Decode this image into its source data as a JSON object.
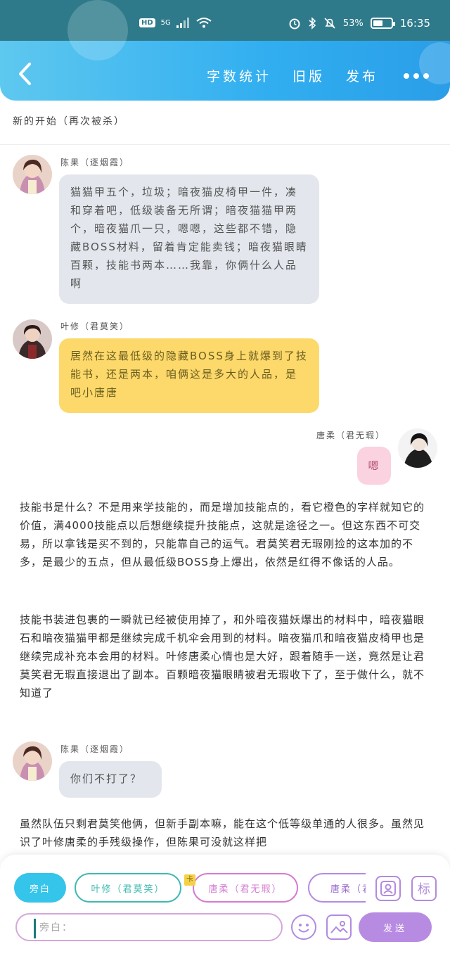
{
  "status_bar": {
    "network_badge": "HD",
    "signal_label": "5G",
    "battery_percent": "53%",
    "time": "16:35",
    "battery_level": 0.53
  },
  "header": {
    "actions": [
      "字数统计",
      "旧版",
      "发布"
    ]
  },
  "chapter": {
    "title": "新的开始（再次被杀）"
  },
  "messages": [
    {
      "speaker": "陈果（逐烟霞）",
      "style": "gray",
      "side": "left",
      "text": "猫猫甲五个，垃圾；暗夜猫皮椅甲一件，凑和穿着吧，低级装备无所谓；暗夜猫猫甲两个，暗夜猫爪一只，嗯嗯，这些都不错，隐藏BOSS材料，留着肯定能卖钱；暗夜猫眼睛百颗，技能书两本……我靠，你俩什么人品啊"
    },
    {
      "speaker": "叶修（君莫笑）",
      "style": "yellow",
      "side": "left",
      "text": "居然在这最低级的隐藏BOSS身上就爆到了技能书，还是两本，咱俩这是多大的人品，是吧小唐唐"
    },
    {
      "speaker": "唐柔（君无瑕）",
      "style": "pink",
      "side": "right",
      "text": "嗯"
    },
    {
      "speaker": "陈果（逐烟霞）",
      "style": "gray",
      "side": "left",
      "text": "你们不打了？"
    }
  ],
  "narrations": [
    "技能书是什么？不是用来学技能的，而是增加技能点的，看它橙色的字样就知它的价值，满4000技能点以后想继续提升技能点，这就是途径之一。但这东西不可交易，所以拿钱是买不到的，只能靠自己的运气。君莫笑君无瑕刚捡的这本加的不多，是最少的五点，但从最低级BOSS身上爆出，依然是红得不像话的人品。",
    "技能书装进包裹的一瞬就已经被使用掉了，和外暗夜猫妖爆出的材料中，暗夜猫眼石和暗夜猫猫甲都是继续完成千机伞会用到的材料。暗夜猫爪和暗夜猫皮椅甲也是继续完成补充本会用的材料。叶修唐柔心情也是大好，跟着随手一送，竟然是让君莫笑君无瑕直接退出了副本。百颗暗夜猫眼睛被君无瑕收下了，至于做什么，就不知道了",
    "虽然队伍只剩君莫笑他俩，但新手副本嘛，能在这个低等级单通的人很多。虽然见识了叶修唐柔的手残级操作，但陈果可没就这样把"
  ],
  "bottom": {
    "roles": [
      "旁白",
      "叶修（君莫笑）",
      "唐柔（君无瑕）",
      "唐柔（君无瑕）"
    ],
    "pin_mark": "卡",
    "tag_button": "标",
    "input_placeholder": "旁白：",
    "send_label": "发送"
  },
  "colors": {
    "header": "#31aef0",
    "narrator_chip": "#35c4ea",
    "send": "#b88be3",
    "bubble_gray": "#e3e7ed",
    "bubble_yellow": "#fcd96a",
    "bubble_pink": "#fbd2df"
  }
}
